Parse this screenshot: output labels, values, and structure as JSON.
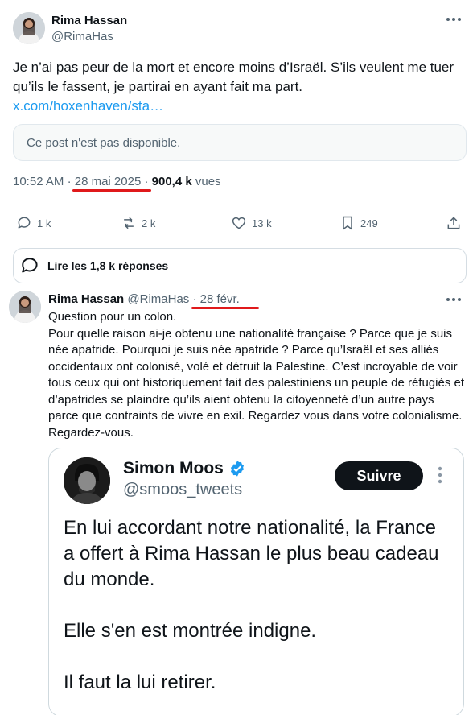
{
  "post": {
    "author_name": "Rima Hassan",
    "author_handle": "@RimaHas",
    "text": "Je n’ai pas peur de la mort et encore moins d’Israël. S’ils veulent me tuer qu’ils le fassent, je partirai en ayant fait ma part.",
    "link": "x.com/hoxenhaven/sta…",
    "unavailable": "Ce post n'est pas disponible.",
    "time": "10:52 AM",
    "date": "28 mai 2025",
    "views_count": "900,4 k",
    "views_label": "vues"
  },
  "actions": {
    "replies": "1 k",
    "reposts": "2 k",
    "likes": "13 k",
    "bookmarks": "249"
  },
  "read_replies": "Lire les 1,8 k réponses",
  "reply": {
    "author_name": "Rima Hassan",
    "author_handle": "@RimaHas",
    "separator": "·",
    "date": "28 févr.",
    "text": "Question pour un colon.\nPour quelle raison ai-je obtenu une nationalité française ? Parce que je suis née apatride. Pourquoi je suis née apatride ? Parce qu’Israël et ses alliés occidentaux ont colonisé, volé et détruit la Palestine. C’est incroyable de voir tous ceux qui ont historiquement fait des palestiniens un peuple de réfugiés et d’apatrides se plaindre qu’ils aient obtenu la citoyenneté d’un autre pays parce que contraints de vivre en exil. Regardez vous dans votre colonialisme. Regardez-vous."
  },
  "embed": {
    "name": "Simon Moos",
    "handle": "@smoos_tweets",
    "follow_label": "Suivre",
    "text": "En lui accordant notre nationalité, la France a offert à Rima Hassan le plus beau cadeau du monde.\n\nElle s'en est montrée indigne.\n\nIl faut la lui retirer."
  },
  "colors": {
    "accent": "#1d9bf0",
    "annotation": "#e0191b",
    "verified": "#1d9bf0"
  }
}
